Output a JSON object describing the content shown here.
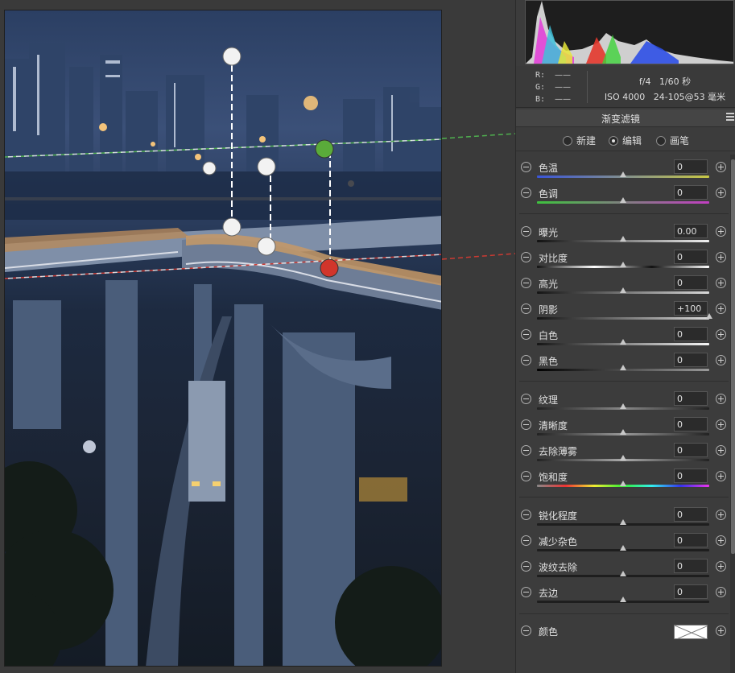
{
  "info": {
    "r_label": "R:",
    "g_label": "G:",
    "b_label": "B:",
    "r_value": "——",
    "g_value": "——",
    "b_value": "——",
    "aperture": "f/4",
    "shutter": "1/60 秒",
    "iso": "ISO 4000",
    "lens": "24-105@53 毫米"
  },
  "panel": {
    "title": "渐变滤镜",
    "modes": [
      {
        "label": "新建",
        "selected": false
      },
      {
        "label": "编辑",
        "selected": true
      },
      {
        "label": "画笔",
        "selected": false
      }
    ]
  },
  "sliders": [
    {
      "label": "色温",
      "value": "0",
      "level": 0.5,
      "track": "linear-gradient(90deg,#3a55d8,#c8c845)"
    },
    {
      "label": "色调",
      "value": "0",
      "level": 0.5,
      "track": "linear-gradient(90deg,#3ec23e,#c23ec2)"
    },
    {
      "label": "曝光",
      "value": "0.00",
      "level": 0.5,
      "track": "linear-gradient(90deg,#111,#f0f0f0)"
    },
    {
      "label": "对比度",
      "value": "0",
      "level": 0.5,
      "track": "linear-gradient(90deg,#111,#fff,#111,#fff)"
    },
    {
      "label": "高光",
      "value": "0",
      "level": 0.5,
      "track": "linear-gradient(90deg,#151515,#d8d8d8)"
    },
    {
      "label": "阴影",
      "value": "+100",
      "level": 1.0,
      "track": "linear-gradient(90deg,#151515,#d8d8d8)"
    },
    {
      "label": "白色",
      "value": "0",
      "level": 0.5,
      "track": "linear-gradient(90deg,#151515,#f8f8f8)"
    },
    {
      "label": "黑色",
      "value": "0",
      "level": 0.5,
      "track": "linear-gradient(90deg,#000,#9a9a9a)"
    },
    {
      "label": "纹理",
      "value": "0",
      "level": 0.5,
      "track": "linear-gradient(90deg,#222,#888,#222)"
    },
    {
      "label": "清晰度",
      "value": "0",
      "level": 0.5,
      "track": "linear-gradient(90deg,#222,#999,#222)"
    },
    {
      "label": "去除薄雾",
      "value": "0",
      "level": 0.5,
      "track": "linear-gradient(90deg,#222,#aaa,#222)"
    },
    {
      "label": "饱和度",
      "value": "0",
      "level": 0.5,
      "track": "linear-gradient(90deg,#888,#e33,#ee3,#3e3,#3ee,#33e,#e3e)"
    },
    {
      "label": "锐化程度",
      "value": "0",
      "level": 0.5,
      "track": "#1e1e1e"
    },
    {
      "label": "减少杂色",
      "value": "0",
      "level": 0.5,
      "track": "#1e1e1e"
    },
    {
      "label": "波纹去除",
      "value": "0",
      "level": 0.5,
      "track": "#1e1e1e"
    },
    {
      "label": "去边",
      "value": "0",
      "level": 0.5,
      "track": "#1e1e1e"
    }
  ],
  "color_row": {
    "label": "颜色"
  },
  "colors": {
    "guide_green": "#4fb04f",
    "guide_red": "#cc3a33",
    "pin_green": "#5aab3a",
    "pin_red": "#d1352b"
  }
}
